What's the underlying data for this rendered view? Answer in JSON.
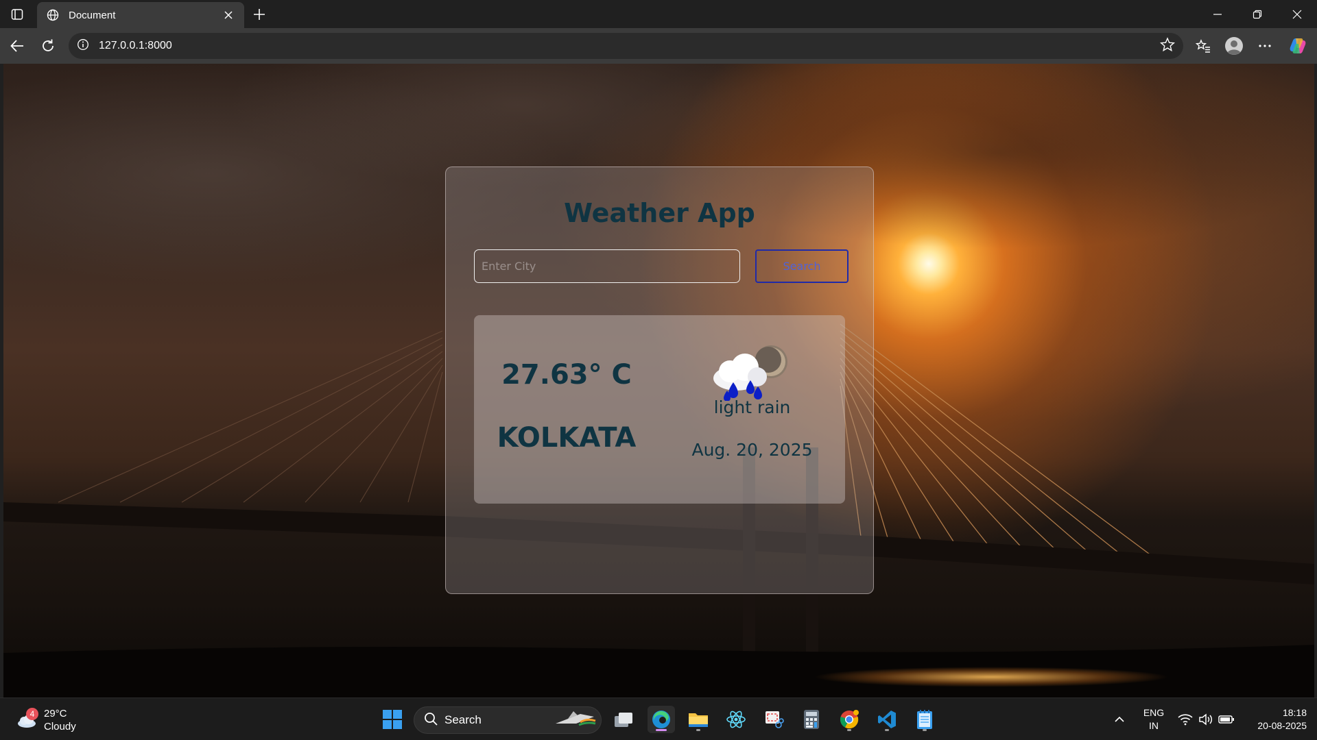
{
  "browser": {
    "tab_title": "Document",
    "url": "127.0.0.1:8000"
  },
  "app": {
    "title": "Weather App",
    "search": {
      "placeholder": "Enter City",
      "value": "",
      "button_label": "Search"
    },
    "result": {
      "temperature": "27.63° C",
      "city": "KOLKATA",
      "description": "light rain",
      "date": "Aug. 20, 2025",
      "icon": "rain-cloud-icon"
    }
  },
  "taskbar": {
    "weather": {
      "badge": "4",
      "temperature": "29°C",
      "condition": "Cloudy"
    },
    "search_label": "Search",
    "language": {
      "line1": "ENG",
      "line2": "IN"
    },
    "clock": {
      "time": "18:18",
      "date": "20-08-2025"
    }
  },
  "colors": {
    "title_text": "#0f3442",
    "search_button_border": "#1f2aa8",
    "browser_chrome": "#202020",
    "taskbar": "#1c1c1c"
  }
}
